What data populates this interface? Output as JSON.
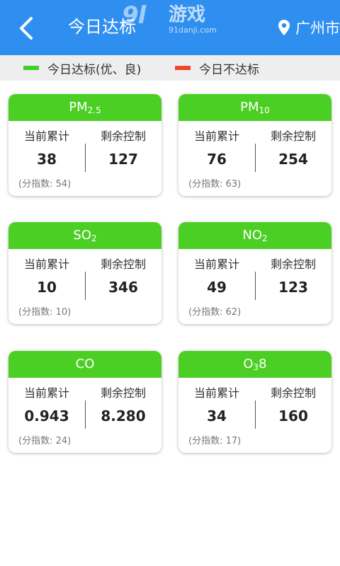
{
  "header": {
    "title": "今日达标",
    "location": "广州市",
    "watermark": {
      "logo": "9l",
      "game": "游戏",
      "url": "91danji.com"
    },
    "colors": {
      "background": "#2f8ff0"
    }
  },
  "legend": [
    {
      "label": "今日达标(优、良)",
      "color": "#3ecf2f"
    },
    {
      "label": "今日不达标",
      "color": "#f2462c"
    }
  ],
  "card_labels": {
    "current": "当前累计",
    "remaining": "剩余控制"
  },
  "cards": [
    {
      "name": "PM",
      "sub": "2.5",
      "suffix": "",
      "current": "38",
      "remaining": "127",
      "sub_index": "(分指数: 54)"
    },
    {
      "name": "PM",
      "sub": "10",
      "suffix": "",
      "current": "76",
      "remaining": "254",
      "sub_index": "(分指数: 63)"
    },
    {
      "name": "SO",
      "sub": "2",
      "suffix": "",
      "current": "10",
      "remaining": "346",
      "sub_index": "(分指数: 10)"
    },
    {
      "name": "NO",
      "sub": "2",
      "suffix": "",
      "current": "49",
      "remaining": "123",
      "sub_index": "(分指数: 62)"
    },
    {
      "name": "CO",
      "sub": "",
      "suffix": "",
      "current": "0.943",
      "remaining": "8.280",
      "sub_index": "(分指数: 24)"
    },
    {
      "name": "O",
      "sub": "3",
      "suffix": "8",
      "current": "34",
      "remaining": "160",
      "sub_index": "(分指数: 17)"
    }
  ]
}
